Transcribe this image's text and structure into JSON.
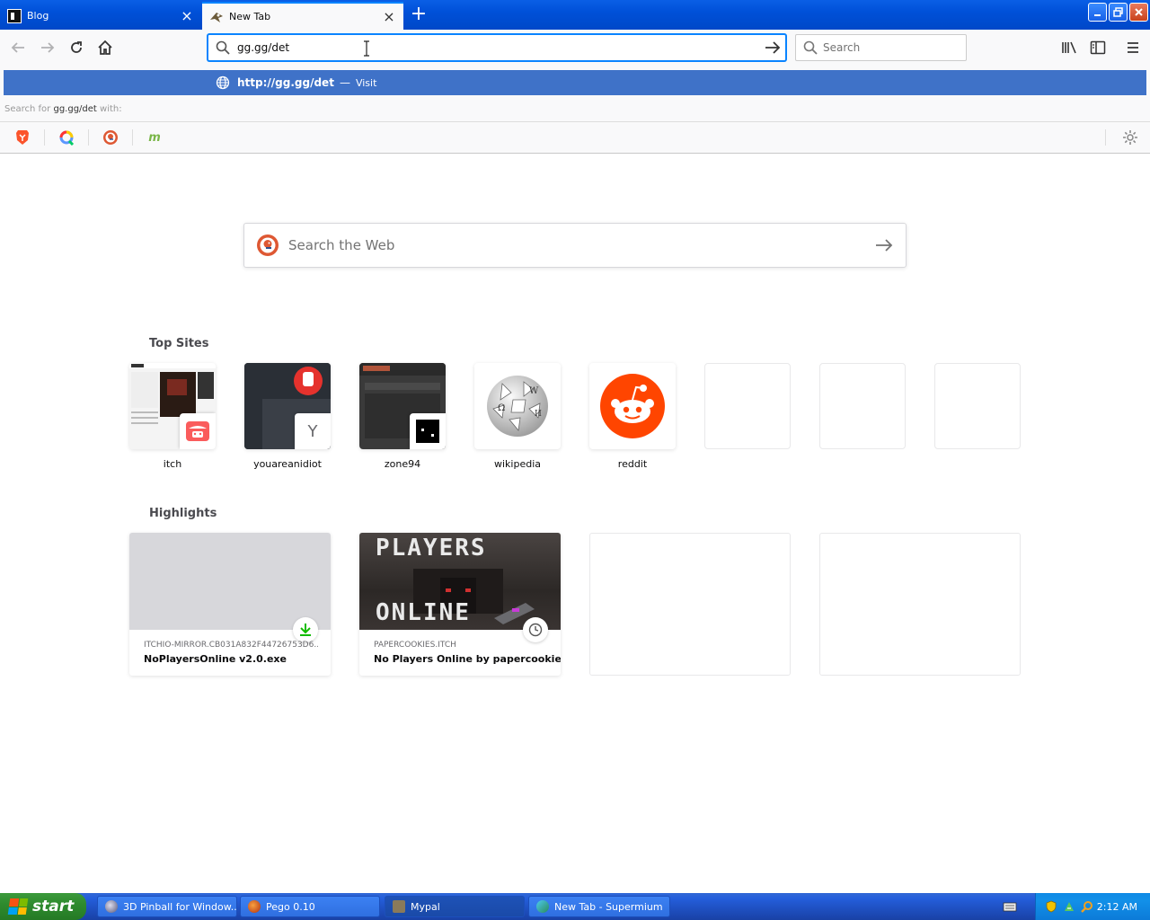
{
  "tabs": [
    {
      "title": "Blog",
      "active": false
    },
    {
      "title": "New Tab",
      "active": true
    }
  ],
  "toolbar": {
    "url_value": "gg.gg/det",
    "search_placeholder": "Search"
  },
  "urlbar_dropdown": {
    "suggestion_url": "http://gg.gg/det",
    "suggestion_separator": "—",
    "suggestion_action": "Visit",
    "search_for_prefix": "Search for",
    "search_for_query": "gg.gg/det",
    "search_for_suffix": "with:",
    "engines": [
      "brave-icon",
      "qwant-icon",
      "duckduckgo-icon",
      "mojeek-icon"
    ],
    "mojeek_glyph": "m"
  },
  "newtab": {
    "web_search_placeholder": "Search the Web",
    "top_sites_title": "Top Sites",
    "top_sites": [
      {
        "label": "itch"
      },
      {
        "label": "youareanidiot",
        "favicon_letter": "Y"
      },
      {
        "label": "zone94"
      },
      {
        "label": "wikipedia"
      },
      {
        "label": "reddit"
      }
    ],
    "highlights_title": "Highlights",
    "highlights": [
      {
        "host": "ITCHIO-MIRROR.CB031A832F44726753D6...",
        "title": "NoPlayersOnline v2.0.exe",
        "badge": "download-icon"
      },
      {
        "host": "PAPERCOOKIES.ITCH",
        "title": "No Players Online by papercookies",
        "badge": "clock-icon",
        "image_text_top": "PLAYERS",
        "image_text_bottom": "ONLINE"
      }
    ]
  },
  "taskbar": {
    "start_label": "start",
    "tasks": [
      {
        "label": "3D Pinball for Window..."
      },
      {
        "label": "Pego 0.10"
      },
      {
        "label": "Mypal"
      },
      {
        "label": "New Tab - Supermium"
      }
    ],
    "clock": "2:12 AM"
  },
  "colors": {
    "accent": "#0a84ff",
    "suggestion_bg": "#3f72c8",
    "reddit": "#ff4500",
    "xp_blue": "#245edb",
    "xp_green": "#2e8b2e"
  }
}
